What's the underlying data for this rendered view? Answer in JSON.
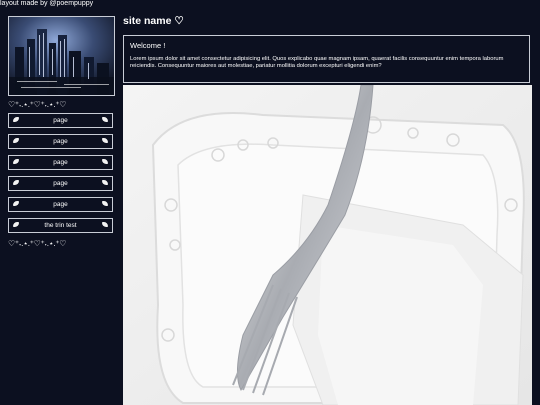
{
  "credit": "layout made by @poempuppy",
  "site": {
    "name": "site name ♡",
    "welcome_heading": "Welcome !",
    "welcome_text": "Lorem ipsum dolor sit amet consectetur adipisicing elit. Quos explicabo quae magnam ipsam, quaerat facilis consequuntur enim tempora laborum reiciendis. Consequuntur maiores aut molestiae, pariatur mollitia dolorum excepturi eligendi enim?"
  },
  "sidebar": {
    "divider": "♡⁺˖.⋆.⁺♡⁺˖.⋆.⁺♡",
    "nav": [
      {
        "label": "page"
      },
      {
        "label": "page"
      },
      {
        "label": "page"
      },
      {
        "label": "page"
      },
      {
        "label": "page"
      },
      {
        "label": "the trin test"
      }
    ]
  },
  "colors": {
    "background": "#0c1020",
    "border": "#c9cdd6",
    "text": "#ffffff"
  }
}
